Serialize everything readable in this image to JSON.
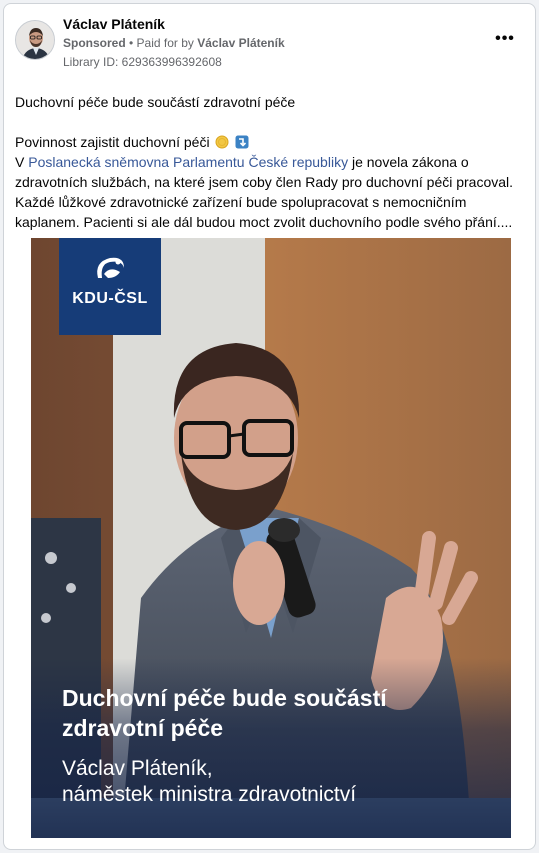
{
  "ad": {
    "author": "Václav Pláteník",
    "sponsored_label": "Sponsored",
    "separator": " • ",
    "paid_for_prefix": "Paid for by ",
    "paid_for_name": "Václav Pláteník",
    "library_id": "Library ID: 629363996392608",
    "more_label": "•••"
  },
  "post": {
    "title_line": "Duchovní péče bude součástí zdravotní péče",
    "line2_text": "Povinnost zajistit duchovní péči",
    "line3_prefix": "V ",
    "line3_link": "Poslanecká sněmovna Parlamentu České republiky",
    "line3_rest": " je novela zákona o zdravotních službách, na které jsem coby člen Rady pro duchovní péči pracoval. Každé lůžkové zdravotnické zařízení bude spolupracovat s nemocničním kaplanem. Pacienti si ale dál budou moct zvolit duchovního podle svého přání...."
  },
  "creative": {
    "logo_text": "KDU-ČSL",
    "headline": "Duchovní péče bude součástí zdravotní péče",
    "name_line": "Václav Pláteník,",
    "role_line": "náměstek ministra zdravotnictví",
    "colors": {
      "logo_blue": "#163c78",
      "background_wall": "#8a5a3c"
    }
  }
}
